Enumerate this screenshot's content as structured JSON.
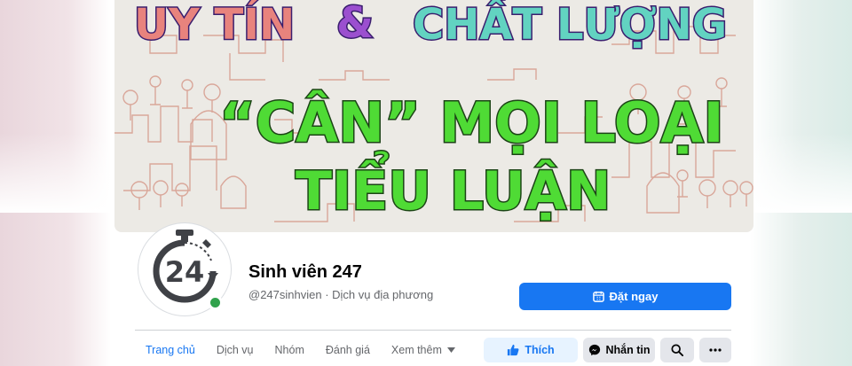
{
  "cover": {
    "line1_left": "UY TÍN",
    "line1_amp": "&",
    "line1_right": "CHẤT LƯỢNG",
    "line2": "“CÂN” MỌI LOẠI",
    "line3": "TIỂU LUẬN"
  },
  "avatar": {
    "number": "24",
    "icon": "stopwatch-icon",
    "online": true
  },
  "profile": {
    "name": "Sinh viên 247",
    "subtitle": "@247sinhvien · Dịch vụ địa phương"
  },
  "book_button": {
    "label": "Đặt ngay",
    "icon": "calendar-icon"
  },
  "tabs": [
    {
      "label": "Trang chủ",
      "active": true
    },
    {
      "label": "Dịch vụ"
    },
    {
      "label": "Nhóm"
    },
    {
      "label": "Đánh giá"
    },
    {
      "label": "Xem thêm",
      "icon": "caret-down-icon"
    }
  ],
  "actions": {
    "like_label": "Thích",
    "message_label": "Nhắn tin",
    "search_icon": "search-icon",
    "more_icon": "more-icon"
  },
  "colors": {
    "accent": "#1877f2",
    "cover_bg": "#eceae5",
    "green_text": "#4fdb35",
    "salmon_text": "#e8837d",
    "teal_text": "#62d3c1",
    "purple_text": "#9b4fcf",
    "online": "#31a24c"
  }
}
